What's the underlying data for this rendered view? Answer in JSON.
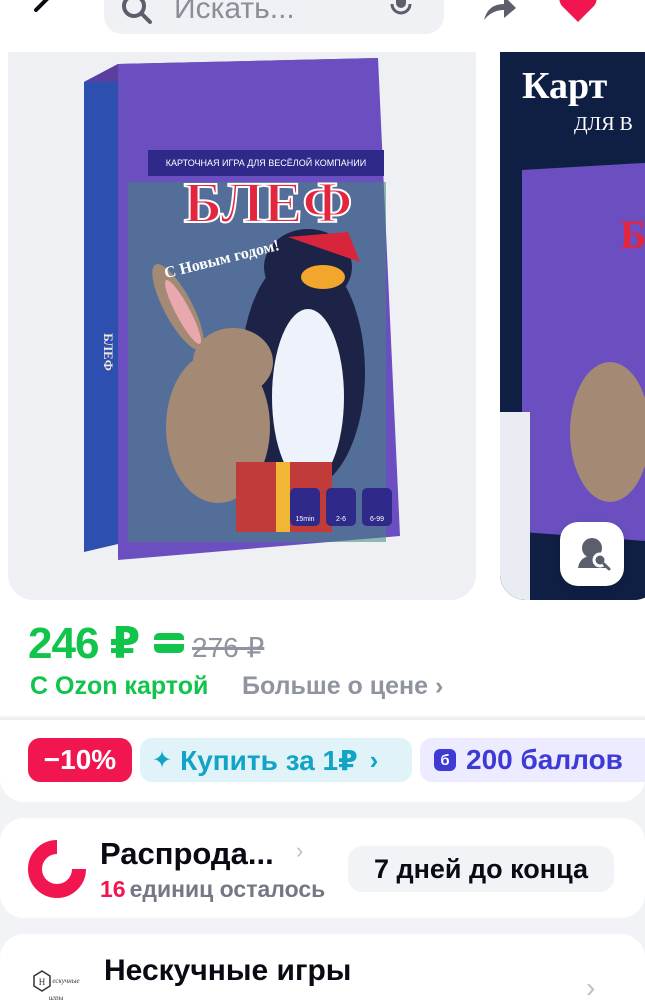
{
  "header": {
    "search_placeholder": "Искать...",
    "icons": [
      "back-arrow-icon",
      "search-icon",
      "microphone-icon",
      "share-icon",
      "heart-icon"
    ]
  },
  "gallery": {
    "main_box": {
      "subtitle": "КАРТОЧНАЯ ИГРА ДЛЯ ВЕСЁЛОЙ КОМПАНИИ",
      "title": "БЛЕФ",
      "tagline": "С Новым годом!",
      "icon_labels": [
        "15min",
        "2-6",
        "6-99"
      ]
    },
    "next_box": {
      "title": "Карт",
      "subtitle": "ДЛЯ В"
    },
    "image_search_icon": "image-search-icon"
  },
  "price": {
    "current": "246 ₽",
    "old": "276 ₽",
    "ozon_card_label": "С Ozon картой",
    "more_label": "Больше о цене ›",
    "accent": "#10c44c"
  },
  "badges": {
    "discount": "−10%",
    "buy_for": "Купить за 1₽",
    "points_icon": "б",
    "points": "200 баллов"
  },
  "sale": {
    "title": "Распрода...",
    "left_count": "16",
    "left_text": "единиц осталось",
    "days": "7 дней до конца",
    "accent": "#f1164f"
  },
  "seller": {
    "name": "Нескучные игры",
    "logo_text": "Нескучные игры"
  }
}
